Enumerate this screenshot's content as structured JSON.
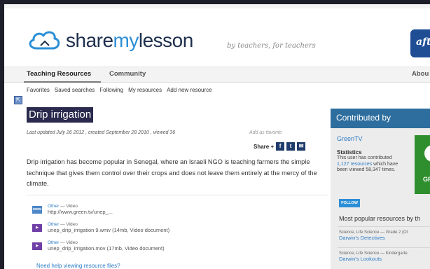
{
  "header": {
    "logo_share": "share",
    "logo_my": "my",
    "logo_lesson": "lesson",
    "tagline": "by teachers, for teachers",
    "aft_badge": "aft"
  },
  "nav": {
    "items": [
      {
        "label": "Teaching Resources"
      },
      {
        "label": "Community"
      },
      {
        "label": "Abou"
      }
    ]
  },
  "subnav": {
    "items": [
      "Favorites",
      "Saved searches",
      "Following",
      "My resources",
      "Add new resource"
    ]
  },
  "resource": {
    "title": "Drip irrigation",
    "meta": "Last updated July 26 2012 , created September 28 2010 , viewed 36",
    "add_favorite": "Add as favorite",
    "share_label": "Share +",
    "description": "Drip irrigation has become popular in Senegal, where an Israeli NGO is teaching farmers the simple technique that gives them control over their crops and does not leave them entirely at the mercy of the climate.",
    "files": [
      {
        "icon": "www",
        "kind_prefix": "Other",
        "kind_suffix": "— Video",
        "name": "http://www.green.tv/unep_..."
      },
      {
        "icon": "video",
        "kind_prefix": "Other",
        "kind_suffix": "— Video",
        "name": "unep_drip_irrigation 9.wmv (14mb, Video document)"
      },
      {
        "icon": "video",
        "kind_prefix": "Other",
        "kind_suffix": "— Video",
        "name": "unep_drip_irrigation.mov (17mb, Video document)"
      }
    ],
    "help": "Need help viewing resource files?"
  },
  "sidebar": {
    "heading": "Contributed by",
    "contributor": "GreenTV",
    "stats_heading": "Statistics",
    "stats_text_1": "This user has contributed",
    "stats_count": "1,127",
    "stats_link": "resources",
    "stats_text_2": "which have been viewed 58,347 times.",
    "follow": "FOLLOW",
    "popular_heading": "Most popular resources by th",
    "logo_letters": "GR",
    "popular": [
      {
        "category": "Science, Life Science — Grade 2 (Ot",
        "title": "Darwin's Detectives"
      },
      {
        "category": "Science, Life Science — Kindergarte",
        "title": "Darwin's Lookouts"
      }
    ]
  },
  "colors": {
    "brand_dark": "#1e2f4d",
    "brand_blue": "#2c8fd6",
    "sidebar_header": "#2d6e9e",
    "title_highlight": "#2a2a4e",
    "link": "#2c7bc6"
  }
}
